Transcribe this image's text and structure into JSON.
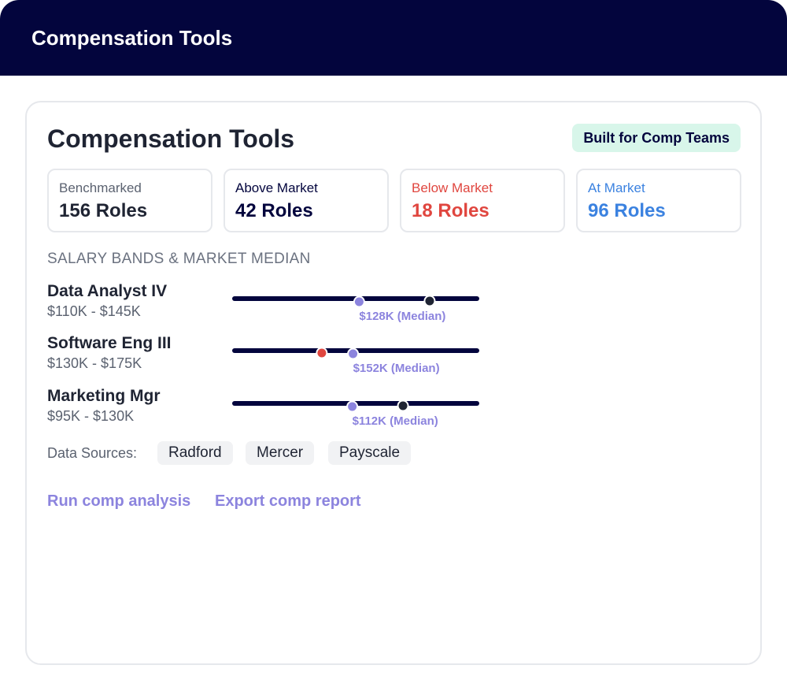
{
  "app": {
    "title": "Compensation Tools"
  },
  "panel": {
    "title": "Compensation Tools",
    "badge": "Built for Comp Teams"
  },
  "stats": [
    {
      "label": "Benchmarked",
      "value": "156 Roles",
      "label_color": "#5b6270",
      "value_color": "#1f2433"
    },
    {
      "label": "Above Market",
      "value": "42 Roles",
      "label_color": "#03053d",
      "value_color": "#03053d"
    },
    {
      "label": "Below Market",
      "value": "18 Roles",
      "label_color": "#e0463f",
      "value_color": "#e0463f"
    },
    {
      "label": "At Market",
      "value": "96 Roles",
      "label_color": "#3b82e0",
      "value_color": "#3b82e0"
    }
  ],
  "bands": {
    "section_label": "SALARY BANDS & MARKET MEDIAN",
    "colors": {
      "track": "#03053d",
      "median": "#8c84de",
      "current_default": "#1f2433",
      "current_below": "#e0463f"
    },
    "rows": [
      {
        "name": "Data Analyst IV",
        "range": "$110K - $145K",
        "min": 110,
        "max": 145,
        "median": 128,
        "median_label": "$128K (Median)",
        "current_fraction": 0.805,
        "current_status": "default"
      },
      {
        "name": "Software Eng III",
        "range": "$130K - $175K",
        "min": 130,
        "max": 175,
        "median": 152,
        "median_label": "$152K (Median)",
        "current_fraction": 0.36,
        "current_status": "below"
      },
      {
        "name": "Marketing Mgr",
        "range": "$95K - $130K",
        "min": 95,
        "max": 130,
        "median": 112,
        "median_label": "$112K (Median)",
        "current_fraction": 0.695,
        "current_status": "default"
      }
    ]
  },
  "sources": {
    "label": "Data Sources:",
    "items": [
      "Radford",
      "Mercer",
      "Payscale"
    ]
  },
  "actions": {
    "run": "Run comp analysis",
    "export": "Export comp report"
  }
}
